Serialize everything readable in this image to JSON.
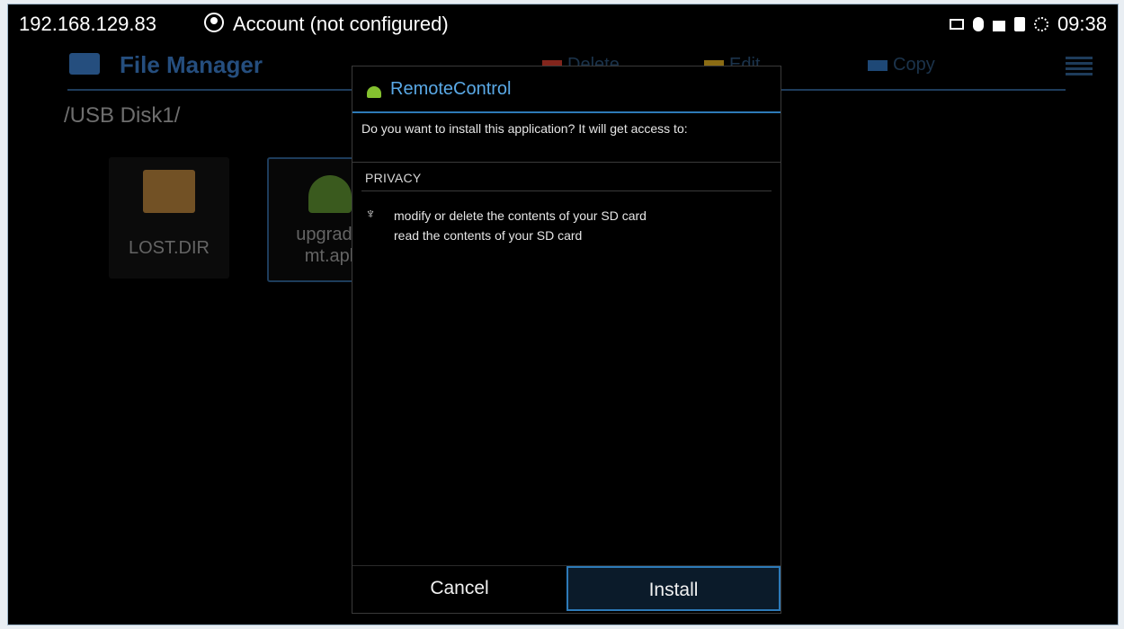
{
  "status_bar": {
    "ip": "192.168.129.83",
    "account_label": "Account (not configured)",
    "time": "09:38",
    "icons": [
      "screen-icon",
      "mouse-icon",
      "lock-icon",
      "sd-card-icon",
      "sync-icon"
    ]
  },
  "file_manager": {
    "title": "File Manager",
    "actions": [
      {
        "label": "Delete",
        "color": "#c83a2b"
      },
      {
        "label": "Edit",
        "color": "#d6a71f"
      },
      {
        "label": "Copy",
        "color": "#2f6fb5"
      }
    ],
    "path": "/USB Disk1/",
    "files": [
      {
        "name": "LOST.DIR",
        "type": "folder"
      },
      {
        "name_line1": "upgrade",
        "name_line2": "mt.apl",
        "type": "apk"
      }
    ]
  },
  "dialog": {
    "app_name": "RemoteControl",
    "question": "Do you want to install this application? It will get access to:",
    "section": "PRIVACY",
    "permissions": [
      "modify or delete the contents of your SD card",
      "read the contents of your SD card"
    ],
    "cancel_label": "Cancel",
    "install_label": "Install"
  },
  "colors": {
    "accent": "#2d7ab8",
    "title_blue": "#5aa9e6",
    "background": "#000000"
  }
}
